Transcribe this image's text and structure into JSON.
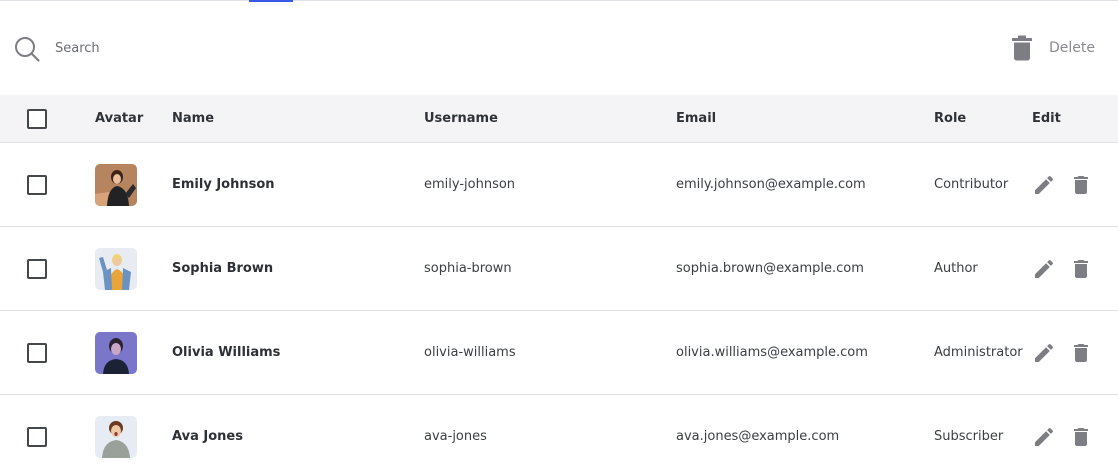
{
  "toolbar": {
    "search_placeholder": "Search",
    "search_icon": "search-icon",
    "delete_label": "Delete",
    "delete_icon": "trash-icon"
  },
  "colors": {
    "accent": "#3858e9",
    "header_bg": "#f4f4f6",
    "border": "#e2e2e6",
    "icon_gray": "#7d7d84"
  },
  "table": {
    "columns": [
      "Avatar",
      "Name",
      "Username",
      "Email",
      "Role",
      "Edit"
    ],
    "rows": [
      {
        "name": "Emily Johnson",
        "username": "emily-johnson",
        "email": "emily.johnson@example.com",
        "role": "Contributor"
      },
      {
        "name": "Sophia Brown",
        "username": "sophia-brown",
        "email": "sophia.brown@example.com",
        "role": "Author"
      },
      {
        "name": "Olivia Williams",
        "username": "olivia-williams",
        "email": "olivia.williams@example.com",
        "role": "Administrator"
      },
      {
        "name": "Ava Jones",
        "username": "ava-jones",
        "email": "ava.jones@example.com",
        "role": "Subscriber"
      }
    ],
    "row_actions": [
      "pencil-icon",
      "trash-icon"
    ]
  }
}
